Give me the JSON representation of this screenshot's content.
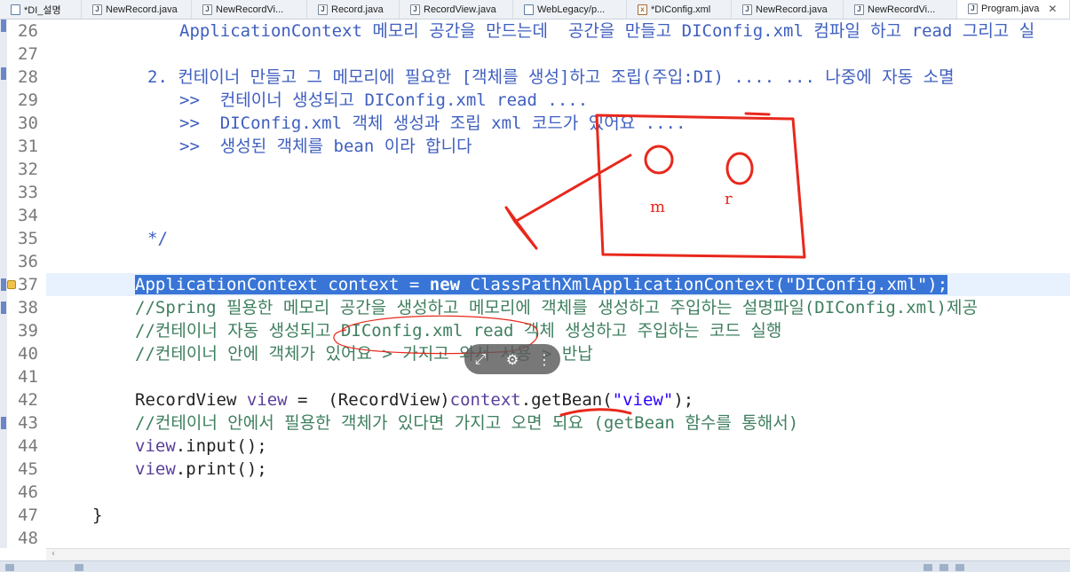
{
  "tabs": [
    {
      "label": "*DI_설명",
      "icon": "document-icon",
      "kind": "doc",
      "active": false
    },
    {
      "label": "NewRecord.java",
      "icon": "java-file-icon",
      "kind": "java",
      "active": false
    },
    {
      "label": "NewRecordVi...",
      "icon": "java-file-icon",
      "kind": "java",
      "active": false
    },
    {
      "label": "Record.java",
      "icon": "java-file-icon",
      "kind": "java",
      "active": false
    },
    {
      "label": "RecordView.java",
      "icon": "java-file-icon",
      "kind": "java",
      "active": false
    },
    {
      "label": "WebLegacy/p...",
      "icon": "web-file-icon",
      "kind": "doc",
      "active": false
    },
    {
      "label": "*DIConfig.xml",
      "icon": "xml-file-icon",
      "kind": "xml",
      "active": false
    },
    {
      "label": "NewRecord.java",
      "icon": "java-file-icon",
      "kind": "java",
      "active": false
    },
    {
      "label": "NewRecordVi...",
      "icon": "java-file-icon",
      "kind": "java",
      "active": false
    },
    {
      "label": "Program.java",
      "icon": "java-file-icon",
      "kind": "java",
      "active": true,
      "close": "✕"
    }
  ],
  "editor": {
    "line_numbers": [
      "26",
      "27",
      "28",
      "29",
      "30",
      "31",
      "32",
      "33",
      "34",
      "35",
      "36",
      "37",
      "38",
      "39",
      "40",
      "41",
      "42",
      "43",
      "44",
      "45",
      "46",
      "47",
      "48"
    ],
    "lines": {
      "l26": "ApplicationContext 메모리 공간을 만드는데  공간을 만들고 DIConfig.xml 컴파일 하고 read 그리고 실",
      "l28": "2. 컨테이너 만들고 그 메모리에 필요한 [객체를 생성]하고 조립(주입:DI) .... ... 나중에 자동 소멸",
      "l29": ">>  컨테이너 생성되고 DIConfig.xml read ....",
      "l30": ">>  DIConfig.xml 객체 생성과 조립 xml 코드가 있어요 ....",
      "l31": ">>  생성된 객체를 bean 이라 합니다",
      "l35": "*/",
      "l37": {
        "t1": "ApplicationContext",
        "t2": " ",
        "t3": "context",
        "t4": " = ",
        "t5": "new",
        "t6": " ClassPathXmlApplicationContext(",
        "t7": "\"DIConfig.xml\"",
        "t8": ");"
      },
      "l38": "//Spring 필용한 메모리 공간을 생성하고 메모리에 객체를 생성하고 주입하는 설명파일(DIConfig.xml)제공",
      "l39": "//컨테이너 자동 생성되고 DIConfig.xml read 객체 생성하고 주입하는 코드 실행",
      "l40": "//컨테이너 안에 객체가 있어요 > 가지고 와서 사용 > 반납",
      "l42": {
        "t1": "RecordView",
        "t2": " ",
        "t3": "view",
        "t4": " =  (RecordView)",
        "t5": "context",
        "t6": ".getBean(",
        "t7": "\"view\"",
        "t8": ");"
      },
      "l43": "//컨테이너 안에서 필용한 객체가 있다면 가지고 오면 되요 (getBean 함수를 통해서)",
      "l44": {
        "obj": "view",
        "rest": ".input();"
      },
      "l45": {
        "obj": "view",
        "rest": ".print();"
      },
      "l47": "}"
    }
  },
  "annotations": {
    "labels": {
      "left": "m",
      "right": "r"
    },
    "ink_color": "#e8281c"
  },
  "video_controls": {
    "icons": [
      "fullscreen-icon",
      "settings-icon",
      "more-icon"
    ],
    "glyphs": [
      "⤢",
      "⚙",
      "⋮"
    ]
  },
  "colors": {
    "keyword": "#7f0055",
    "string": "#2a00ff",
    "javadoc": "#3f5fbf",
    "comment": "#3f7f5f",
    "selection": "#3875d7",
    "current_line": "#e8f2fe"
  }
}
